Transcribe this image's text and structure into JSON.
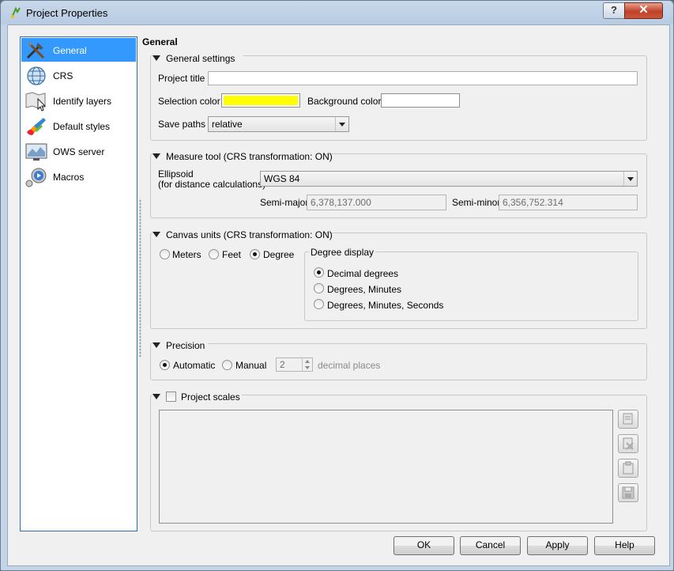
{
  "window": {
    "title": "Project Properties",
    "help_label": "?",
    "close_label": "✕"
  },
  "sidebar": {
    "items": [
      {
        "label": "General",
        "icon": "general-icon"
      },
      {
        "label": "CRS",
        "icon": "globe-icon"
      },
      {
        "label": "Identify layers",
        "icon": "identify-icon"
      },
      {
        "label": "Default styles",
        "icon": "styles-icon"
      },
      {
        "label": "OWS server",
        "icon": "ows-icon"
      },
      {
        "label": "Macros",
        "icon": "macros-icon"
      }
    ],
    "selected": "General"
  },
  "page": {
    "title": "General"
  },
  "general_settings": {
    "title": "General settings",
    "project_title_label": "Project title",
    "project_title_value": "",
    "selection_color_label": "Selection color",
    "selection_color": "#ffff00",
    "background_color_label": "Background color",
    "background_color": "#ffffff",
    "save_paths_label": "Save paths",
    "save_paths_value": "relative"
  },
  "measure_tool": {
    "title": "Measure tool (CRS transformation: ON)",
    "ellipsoid_label_1": "Ellipsoid",
    "ellipsoid_label_2": "(for distance calculations)",
    "ellipsoid_value": "WGS 84",
    "semi_major_label": "Semi-major",
    "semi_major_value": "6,378,137.000",
    "semi_minor_label": "Semi-minor",
    "semi_minor_value": "6,356,752.314"
  },
  "canvas_units": {
    "title": "Canvas units (CRS transformation: ON)",
    "units": [
      "Meters",
      "Feet",
      "Degree"
    ],
    "selected_unit": "Degree",
    "degree_display_title": "Degree display",
    "degree_options": [
      "Decimal degrees",
      "Degrees, Minutes",
      "Degrees, Minutes, Seconds"
    ],
    "selected_degree_option": "Decimal degrees"
  },
  "precision": {
    "title": "Precision",
    "automatic_label": "Automatic",
    "manual_label": "Manual",
    "selected": "Automatic",
    "decimal_value": "2",
    "decimal_places_label": "decimal places"
  },
  "project_scales": {
    "title": "Project scales",
    "checked": false
  },
  "buttons": {
    "ok": "OK",
    "cancel": "Cancel",
    "apply": "Apply",
    "help": "Help"
  }
}
